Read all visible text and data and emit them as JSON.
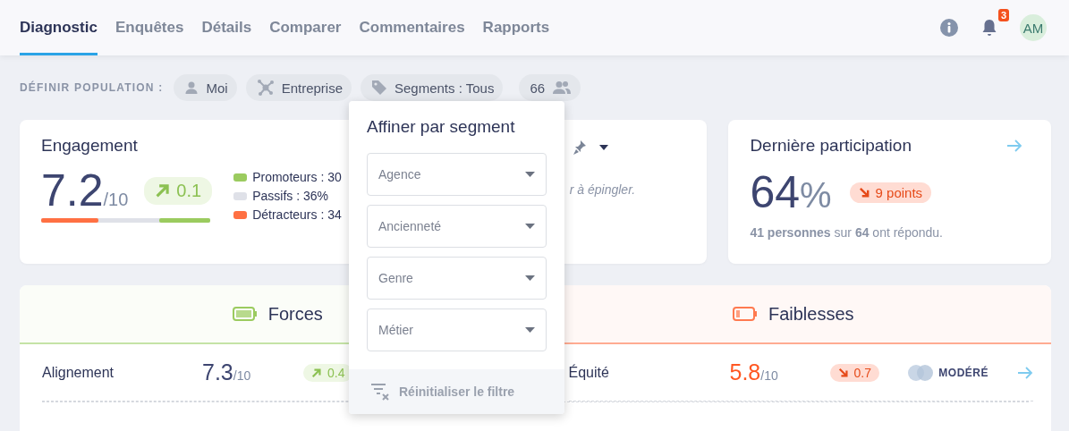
{
  "nav": {
    "tabs": [
      {
        "label": "Diagnostic",
        "selected": true
      },
      {
        "label": "Enquêtes",
        "selected": false
      },
      {
        "label": "Détails",
        "selected": false
      },
      {
        "label": "Comparer",
        "selected": false
      },
      {
        "label": "Commentaires",
        "selected": false
      },
      {
        "label": "Rapports",
        "selected": false
      }
    ],
    "notifications": "3",
    "avatar": "AM"
  },
  "population": {
    "label": "DÉFINIR POPULATION :",
    "chips": [
      {
        "kind": "person",
        "label": "Moi"
      },
      {
        "kind": "company",
        "label": "Entreprise"
      },
      {
        "kind": "segments",
        "label": "Segments : Tous"
      },
      {
        "kind": "count",
        "label": "66"
      }
    ]
  },
  "engagement": {
    "title": "Engagement",
    "score": "7.2",
    "scale": "/10",
    "trend": {
      "kind": "up",
      "value": "0.1"
    },
    "legend": [
      {
        "label": "Promoteurs : 30",
        "color": "#9bcb5f",
        "level": 0.3
      },
      {
        "label": "Passifs : 36%",
        "color": "#dfe1e8"
      },
      {
        "label": "Détracteurs : 34",
        "color": "#ff7043",
        "level": 0.34
      }
    ]
  },
  "pinned": {
    "hint": "r à épingler."
  },
  "participation": {
    "title": "Dernière participation",
    "value": "64",
    "unit": "%",
    "trend": {
      "kind": "down",
      "value": "9 points"
    },
    "summary": "**41 personnes** sur **64** ont répondu."
  },
  "panels": [
    {
      "kind": "strength",
      "title": "Forces",
      "rows": [
        {
          "name": "Alignement",
          "score": "7.3",
          "scale": "/10",
          "trend": {
            "kind": "up",
            "value": "0.4"
          }
        }
      ]
    },
    {
      "kind": "weakness",
      "title": "Faiblesses",
      "rows": [
        {
          "name": "Équité",
          "score": "5.8",
          "scale": "/10",
          "trend": {
            "kind": "down",
            "value": "0.7"
          },
          "confidence": "MODÉRÉ"
        }
      ]
    }
  ],
  "filter_popup": {
    "title": "Affiner par segment",
    "selects": [
      {
        "placeholder": "Agence"
      },
      {
        "placeholder": "Ancienneté"
      },
      {
        "placeholder": "Genre"
      },
      {
        "placeholder": "Métier"
      }
    ],
    "reset": {
      "label": "Réinitialiser le filtre",
      "disabled": true
    }
  }
}
